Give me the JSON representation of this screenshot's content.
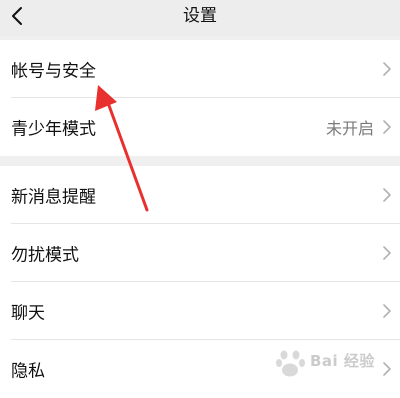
{
  "header": {
    "title": "设置",
    "back_icon": "chevron-left-icon"
  },
  "groups": [
    {
      "items": [
        {
          "label": "帐号与安全",
          "value": ""
        },
        {
          "label": "青少年模式",
          "value": "未开启"
        }
      ]
    },
    {
      "items": [
        {
          "label": "新消息提醒",
          "value": ""
        },
        {
          "label": "勿扰模式",
          "value": ""
        },
        {
          "label": "聊天",
          "value": ""
        },
        {
          "label": "隐私",
          "value": ""
        }
      ]
    }
  ],
  "annotation": {
    "color": "#e8312f"
  },
  "watermark": {
    "text": "Bai 经验"
  },
  "colors": {
    "background": "#f0f0f0",
    "header": "#ededed",
    "row": "#ffffff",
    "secondary_text": "#7a7a7a",
    "chevron": "#b2b2b2"
  }
}
